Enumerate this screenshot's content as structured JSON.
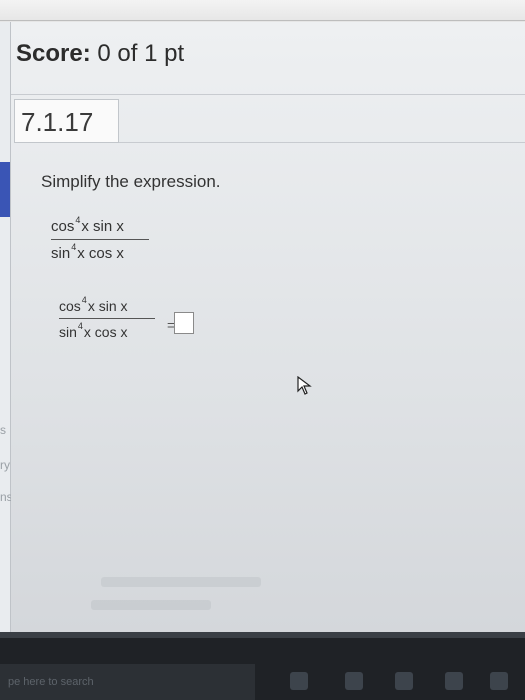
{
  "score": {
    "label": "Score:",
    "value": "0 of 1 pt"
  },
  "question": {
    "id": "7.1.17",
    "prompt": "Simplify the expression."
  },
  "expression": {
    "num_func1": "cos",
    "num_exp": "4",
    "num_rest": "x sin x",
    "den_func1": "sin",
    "den_exp": "4",
    "den_rest": "x cos x"
  },
  "answer": {
    "equals": "="
  },
  "side_labels": {
    "s": "s",
    "ry": "ry",
    "ns": "ns"
  },
  "taskbar": {
    "search_text": "pe here to search"
  },
  "colors": {
    "accent": "#3a55b5",
    "taskbar": "#1f2226"
  }
}
